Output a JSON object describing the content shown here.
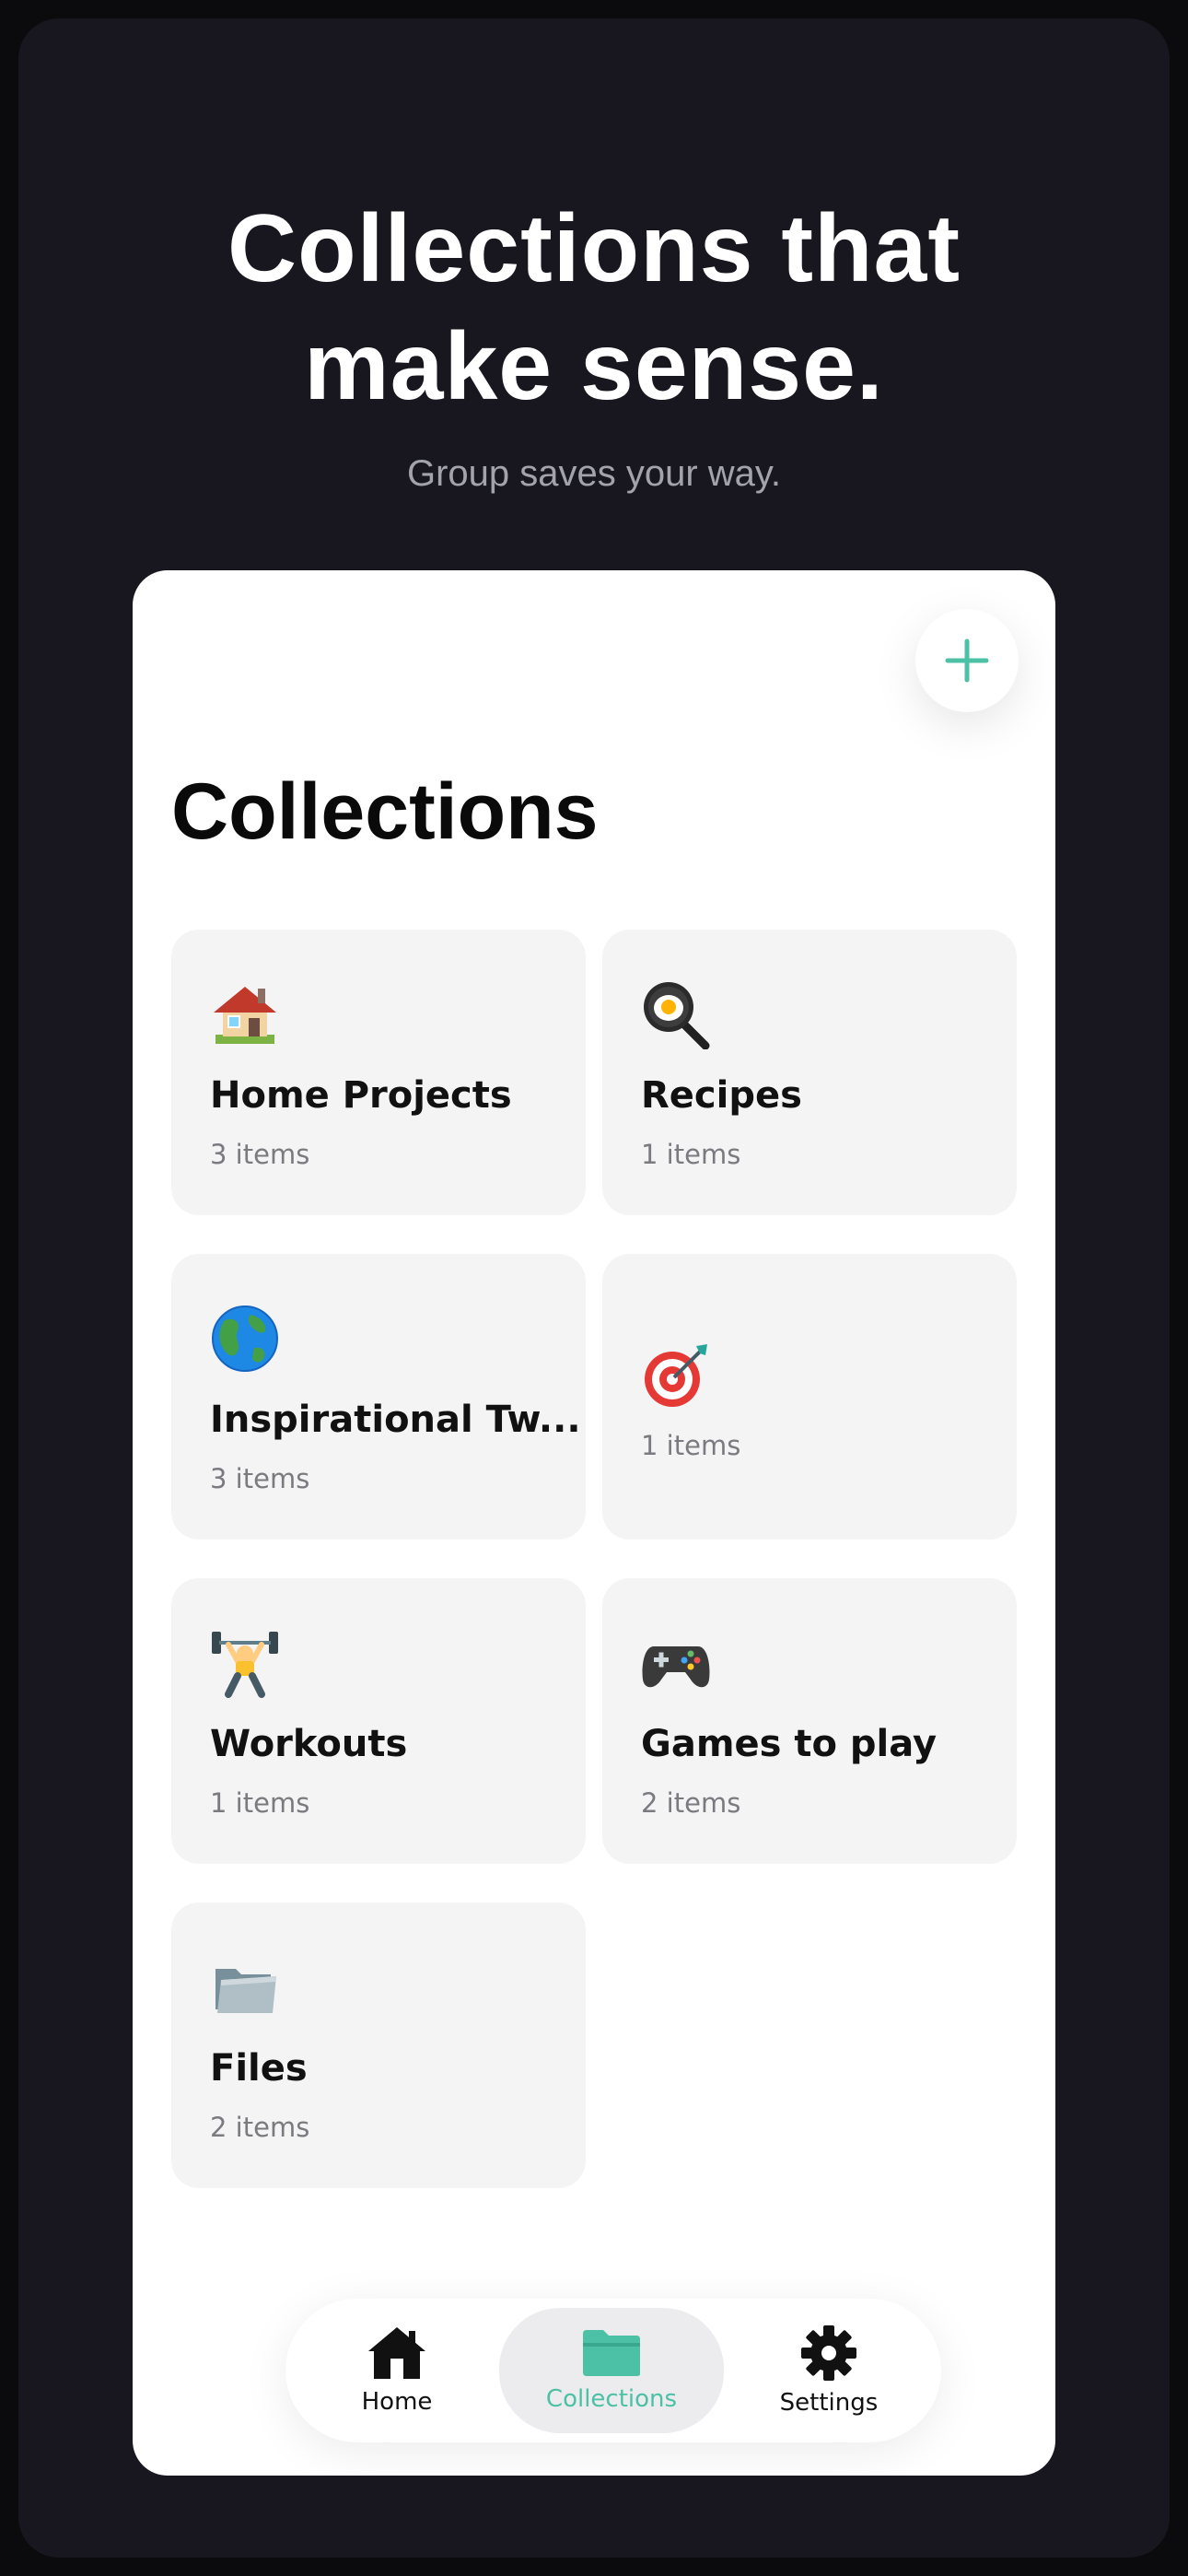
{
  "hero": {
    "title_line1": "Collections that",
    "title_line2": "make sense.",
    "subtitle": "Group saves your way."
  },
  "screen": {
    "title": "Collections",
    "add_button_icon": "plus-icon",
    "accent_color": "#4cc1a5"
  },
  "collections": [
    {
      "emoji": "house",
      "name": "Home Projects",
      "count": "3 items"
    },
    {
      "emoji": "cooking",
      "name": "Recipes",
      "count": "1 items"
    },
    {
      "emoji": "globe-americas",
      "name": "Inspirational Tw...",
      "count": "3 items"
    },
    {
      "emoji": "direct-hit",
      "name": "",
      "count": "1 items"
    },
    {
      "emoji": "weightlifter",
      "name": "Workouts",
      "count": "1 items"
    },
    {
      "emoji": "video-game",
      "name": "Games to play",
      "count": "2 items"
    },
    {
      "emoji": "file-folder",
      "name": "Files",
      "count": "2 items"
    }
  ],
  "tabbar": {
    "items": [
      {
        "label": "Home",
        "icon": "house-icon",
        "active": false
      },
      {
        "label": "Collections",
        "icon": "folder-icon",
        "active": true
      },
      {
        "label": "Settings",
        "icon": "gear-icon",
        "active": false
      }
    ]
  }
}
